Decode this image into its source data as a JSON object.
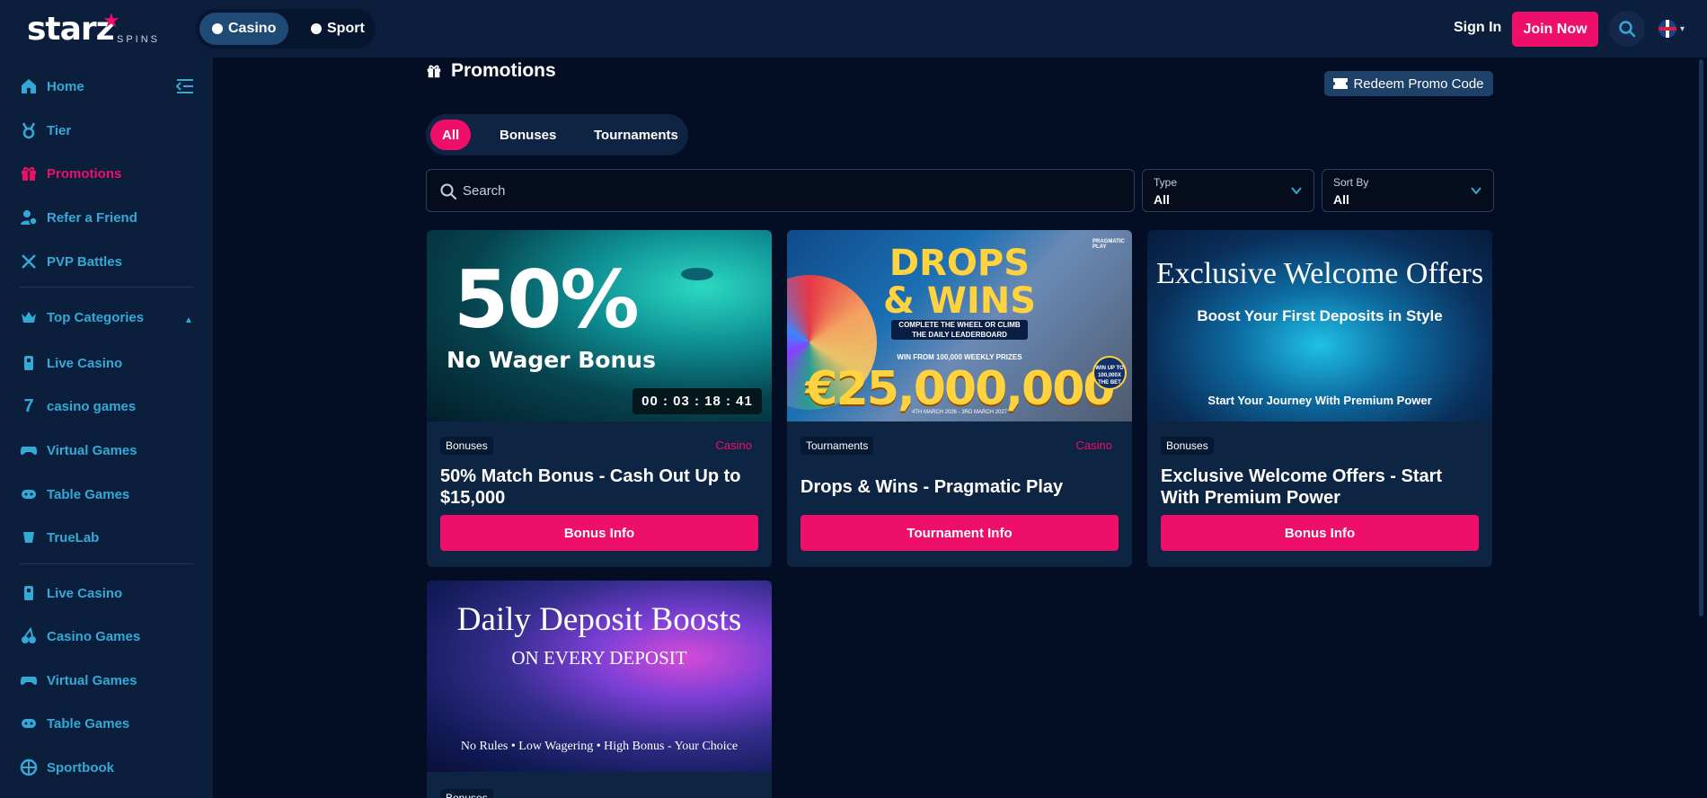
{
  "brand": {
    "logo_text": "starz",
    "logo_sub": "SPINS",
    "accent": "#ed0f69",
    "nav_color": "#35a9d6"
  },
  "header": {
    "modes": [
      {
        "label": "Casino",
        "icon": "casino-chip-icon",
        "active": true
      },
      {
        "label": "Sport",
        "icon": "ball-icon",
        "active": false
      }
    ],
    "sign_in": "Sign In",
    "join": "Join Now",
    "search_icon": "search-icon",
    "language_icon": "uk-flag-icon"
  },
  "sidebar": {
    "items": [
      {
        "label": "Home",
        "icon": "home-icon"
      },
      {
        "label": "Tier",
        "icon": "medal-icon"
      },
      {
        "label": "Promotions",
        "icon": "gift-icon",
        "active": true
      },
      {
        "label": "Refer a Friend",
        "icon": "user-plus-icon"
      },
      {
        "label": "PVP Battles",
        "icon": "swords-icon"
      }
    ],
    "top_categories": "Top Categories",
    "categories": [
      {
        "label": "Live Casino",
        "icon": "dealer-icon"
      },
      {
        "label": "casino games",
        "icon": "seven-icon"
      },
      {
        "label": "Virtual Games",
        "icon": "gamepad-icon"
      },
      {
        "label": "Table Games",
        "icon": "table-icon"
      },
      {
        "label": "TrueLab",
        "icon": "truelab-icon"
      }
    ],
    "more": [
      {
        "label": "Live Casino",
        "icon": "dealer-icon"
      },
      {
        "label": "Casino Games",
        "icon": "cherries-icon"
      },
      {
        "label": "Virtual Games",
        "icon": "gamepad-icon"
      },
      {
        "label": "Table Games",
        "icon": "table-icon"
      },
      {
        "label": "Sportbook",
        "icon": "basketball-icon"
      }
    ]
  },
  "main": {
    "title": "Promotions",
    "redeem": "Redeem Promo Code",
    "tabs": [
      "All",
      "Bonuses",
      "Tournaments"
    ],
    "search_placeholder": "Search",
    "type_label": "Type",
    "type_value": "All",
    "sort_label": "Sort By",
    "sort_value": "All"
  },
  "cards": [
    {
      "tag": "Bonuses",
      "category": "Casino",
      "title": "50% Match Bonus - Cash Out Up to $15,000",
      "button": "Bonus Info",
      "image": {
        "big": "50%",
        "sub": "No Wager Bonus",
        "timer": "00 : 03 : 18 : 41"
      }
    },
    {
      "tag": "Tournaments",
      "category": "Casino",
      "title": "Drops & Wins - Pragmatic Play",
      "button": "Tournament Info",
      "image": {
        "line1": "DROPS",
        "line2": "& WINS",
        "bar": "COMPLETE THE WHEEL OR CLIMB THE DAILY LEADERBOARD",
        "prize": "WIN FROM 100,000 WEEKLY PRIZES",
        "amount": "€25,000,000",
        "dates": "4TH MARCH 2026 - 3RD MARCH 2027",
        "badge": "WIN UP TO 100,000X THE BET",
        "provider": "PRAGMATIC PLAY"
      }
    },
    {
      "tag": "Bonuses",
      "category": "",
      "title": "Exclusive Welcome Offers - Start With Premium Power",
      "button": "Bonus Info",
      "image": {
        "heading": "Exclusive Welcome Offers",
        "sub": "Boost Your First Deposits in Style",
        "foot": "Start Your Journey With Premium Power"
      }
    },
    {
      "tag": "Bonuses",
      "category": "",
      "title": "",
      "button": "",
      "image": {
        "heading": "Daily Deposit Boosts",
        "sub": "ON EVERY DEPOSIT",
        "foot": "No Rules • Low Wagering • High Bonus - Your Choice"
      }
    }
  ]
}
